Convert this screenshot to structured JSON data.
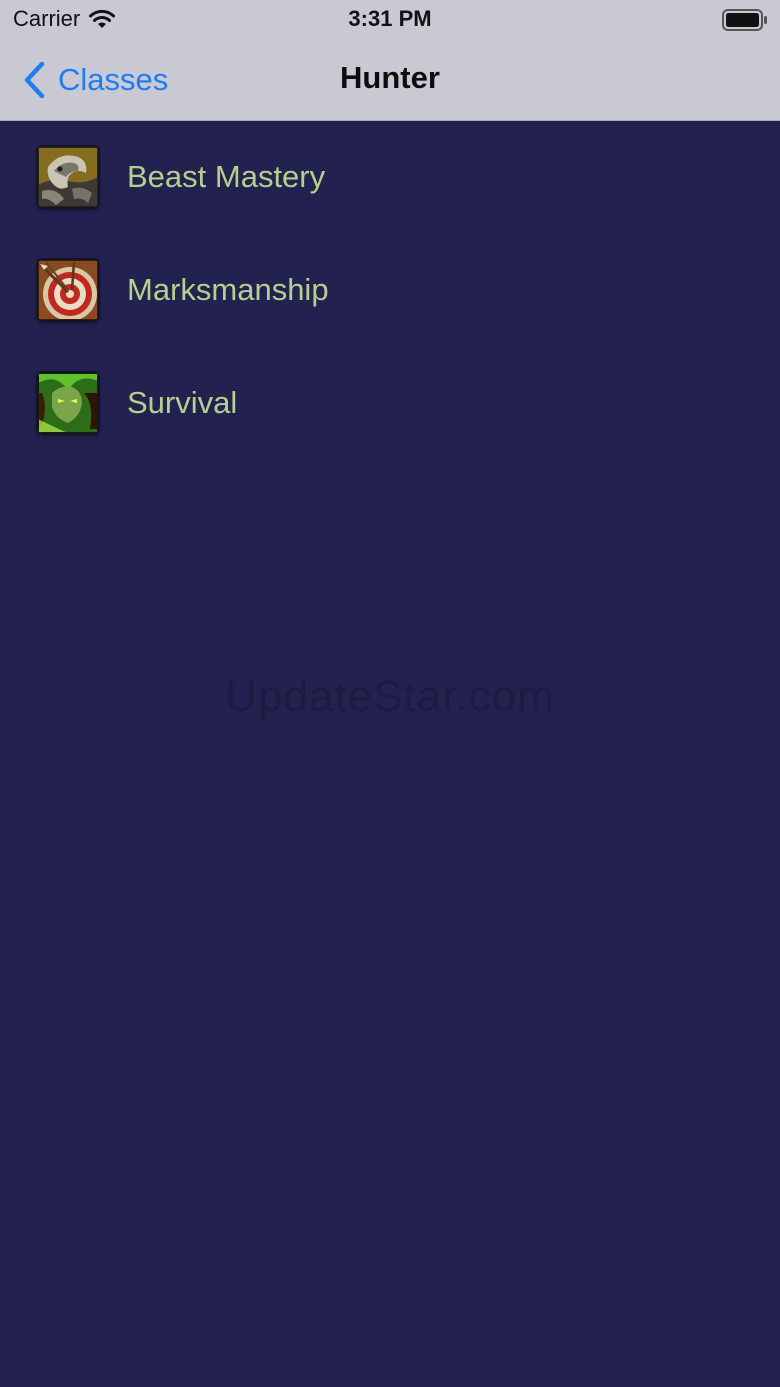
{
  "status_bar": {
    "carrier": "Carrier",
    "time": "3:31 PM"
  },
  "nav": {
    "back_label": "Classes",
    "title": "Hunter"
  },
  "specs": [
    {
      "label": "Beast Mastery",
      "icon": "beast-mastery-icon"
    },
    {
      "label": "Marksmanship",
      "icon": "marksmanship-icon"
    },
    {
      "label": "Survival",
      "icon": "survival-icon"
    }
  ],
  "watermark": "UpdateStar.com",
  "colors": {
    "background": "#22214f",
    "nav_background": "#c9c9d4",
    "accent": "#1f7cf2",
    "spec_text": "#b5cf8d"
  }
}
